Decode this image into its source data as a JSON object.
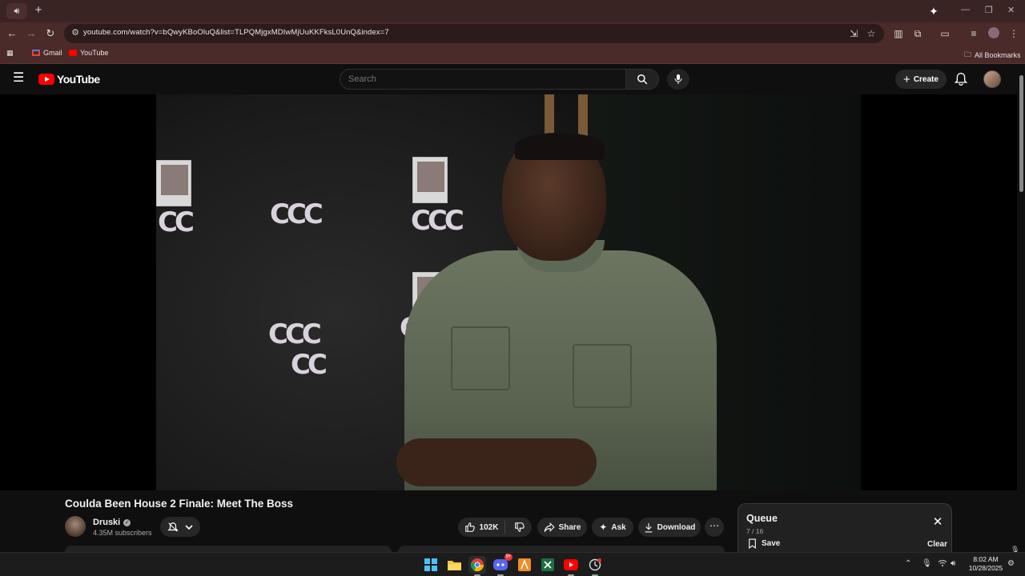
{
  "browser": {
    "url": "youtube.com/watch?v=bQwyKBoOluQ&list=TLPQMjgxMDIwMjUuKKFksL0UnQ&index=7",
    "bookmarks": [
      {
        "label": "Gmail",
        "color": "#ea4335"
      },
      {
        "label": "YouTube",
        "color": "#ff0000"
      }
    ],
    "all_bookmarks_label": "All Bookmarks"
  },
  "masthead": {
    "logo_text": "YouTube",
    "search_placeholder": "Search",
    "create_label": "Create"
  },
  "video": {
    "title": "Coulda Been House 2 Finale: Meet The Boss",
    "channel_name": "Druski",
    "subscribers": "4.35M subscribers",
    "likes": "102K",
    "share_label": "Share",
    "ask_label": "Ask",
    "download_label": "Download"
  },
  "queue": {
    "title": "Queue",
    "count": "7 / 16",
    "save_label": "Save",
    "clear_label": "Clear"
  },
  "taskbar": {
    "time": "8:02 AM",
    "date": "10/28/2025",
    "discord_badge": "9+"
  },
  "colors": {
    "brand_red": "#ff0000",
    "chrome_frame": "#4b2a2a",
    "yt_background": "#0f0f0f"
  }
}
